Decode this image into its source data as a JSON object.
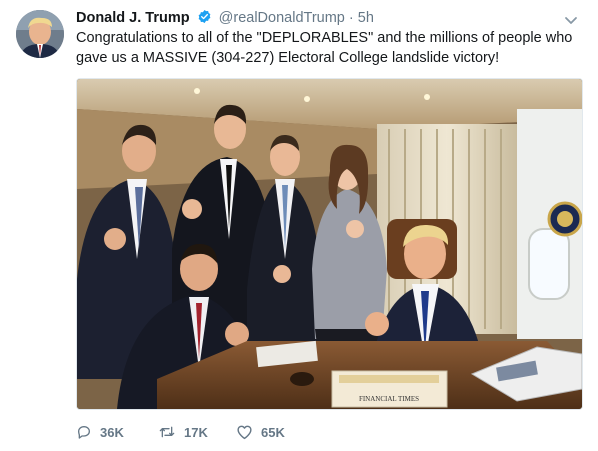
{
  "tweet": {
    "author_name": "Donald J. Trump",
    "handle": "@realDonaldTrump",
    "separator": "·",
    "time": "5h",
    "text": "Congratulations to all of the \"DEPLORABLES\" and the millions of people who gave us a MASSIVE (304-227) Electoral College landslide victory!",
    "newspaper_masthead": "FINANCIAL TIMES",
    "colors": {
      "verified": "#1da1f2",
      "muted": "#657786",
      "text": "#14171a"
    }
  },
  "actions": {
    "replies": "36K",
    "retweets": "17K",
    "likes": "65K",
    "icons": [
      "reply-icon",
      "retweet-icon",
      "like-icon"
    ]
  }
}
